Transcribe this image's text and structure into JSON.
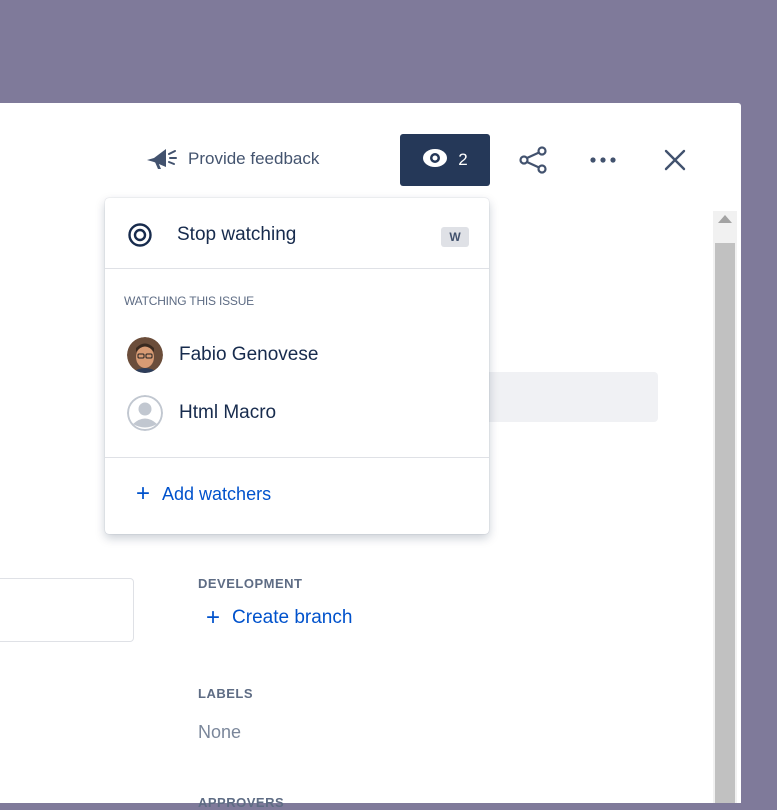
{
  "toolbar": {
    "feedback_label": "Provide feedback",
    "watch_count": "2"
  },
  "dropdown": {
    "stop_watching_label": "Stop watching",
    "shortcut_key": "W",
    "heading": "WATCHING THIS ISSUE",
    "watchers": [
      {
        "name": "Fabio Genovese",
        "avatar": "photo-avatar"
      },
      {
        "name": "Html Macro",
        "avatar": "default-avatar"
      }
    ],
    "add_watchers_label": "Add watchers"
  },
  "sidebar": {
    "development_label": "DEVELOPMENT",
    "create_branch_label": "Create branch",
    "labels_label": "LABELS",
    "labels_value": "None",
    "approvers_label": "APPROVERS"
  },
  "icons": {
    "feedback": "megaphone-icon",
    "watch": "eye-icon",
    "share": "share-icon",
    "more": "more-icon",
    "close": "close-icon"
  },
  "colors": {
    "backdrop": "#7f7a9a",
    "watch_button_bg": "#253858",
    "link": "#0052cc",
    "text_primary": "#172b4d",
    "text_subtle": "#5e6c84"
  }
}
